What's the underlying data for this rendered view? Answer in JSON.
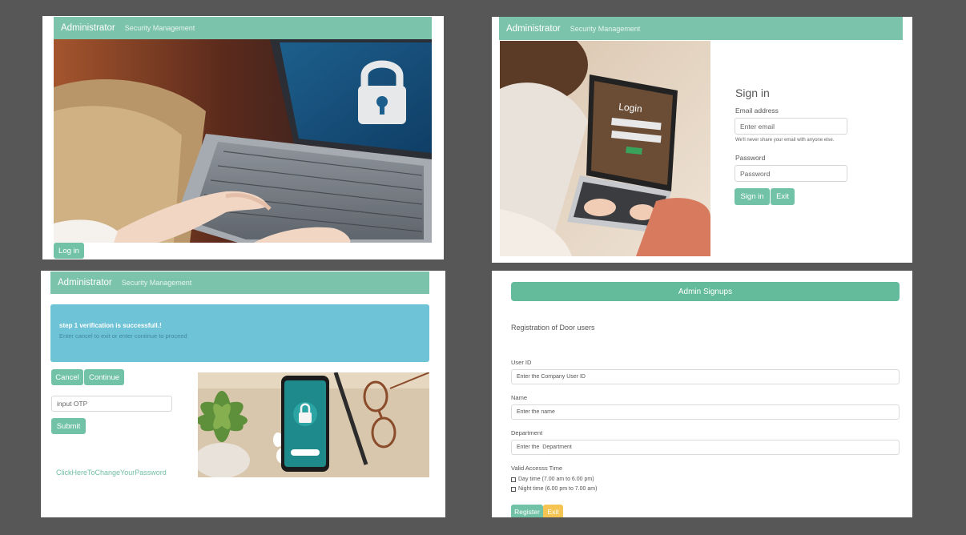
{
  "panel_login": {
    "brand": "Administrator",
    "nav_link": "Security Management",
    "login_button": "Log in",
    "hero_image": "laptop-with-padlock-photo"
  },
  "panel_signin": {
    "brand": "Administrator",
    "nav_link": "Security Management",
    "title": "Sign in",
    "email_label": "Email address",
    "email_placeholder": "Enter email",
    "email_help": "We'll never share your email with anyone else.",
    "password_label": "Password",
    "password_placeholder": "Password",
    "signin_button": "Sign in",
    "exit_button": "Exit",
    "image": "woman-laptop-login-photo"
  },
  "panel_otp": {
    "brand": "Administrator",
    "nav_link": "Security Management",
    "alert_title": "step 1 verification is successfull.!",
    "alert_text": "Enter cancel to exit or enter continue to proceed",
    "cancel_button": "Cancel",
    "continue_button": "Continue",
    "otp_placeholder": "input OTP",
    "submit_button": "Submit",
    "change_password_link": "ClickHereToChangeYourPassword",
    "image": "phone-padlock-desk-photo"
  },
  "panel_signup": {
    "header": "Admin Signups",
    "subtitle": "Registration of Door users",
    "userid_label": "User ID",
    "userid_placeholder": "Enter the Company User ID",
    "name_label": "Name",
    "name_placeholder": "Enter the name",
    "department_label": "Department",
    "department_placeholder": "Enter the  Department",
    "time_label": "Valid Accesss Time",
    "day_option": "Day time (7.00 am to 6.00 pm)",
    "night_option": "Night time (6.00 pm to 7.00 am)",
    "register_button": "Register",
    "exit_button": "Exit"
  },
  "colors": {
    "accent": "#7cc3ab",
    "alert": "#6ec3d6",
    "warning": "#f6c453",
    "background": "#575757"
  }
}
